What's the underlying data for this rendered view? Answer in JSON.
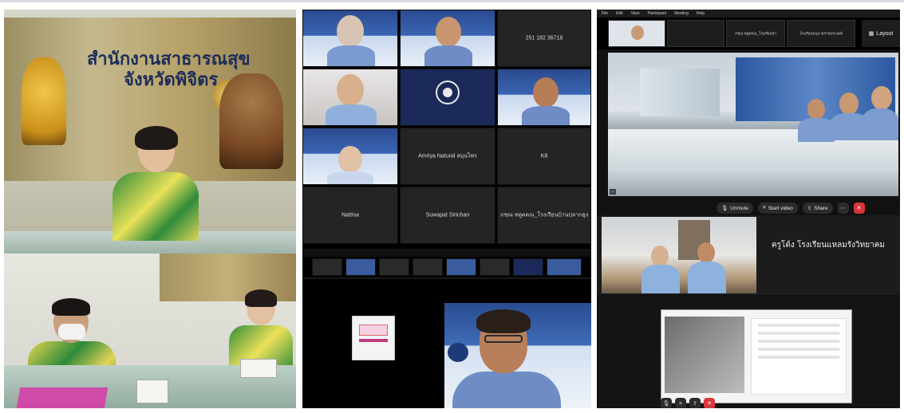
{
  "photo_top": {
    "banner_line1": "สำนักงานสาธารณสุข",
    "banner_line2": "จังหวัดพิจิตร"
  },
  "zoom_gallery": {
    "tiles": [
      {
        "label": ""
      },
      {
        "label": ""
      },
      {
        "label": "251 182 36718"
      },
      {
        "label": ""
      },
      {
        "label": ""
      },
      {
        "label": ""
      },
      {
        "label": ""
      },
      {
        "label": "Amriya Natural สมุนไพร"
      },
      {
        "label": "K8"
      },
      {
        "label": "Nattisa"
      },
      {
        "label": "Suwapat Sirichan"
      },
      {
        "label": "ภชณ หทูดดณ_โรงเรียนบ้านปลากฮุง"
      }
    ]
  },
  "zoom_desktop": {
    "menu": [
      "File",
      "Edit",
      "View",
      "Participant",
      "Meeting",
      "Help"
    ],
    "top_thumbs": [
      "",
      "",
      "ภชณ หทูดดณ_โรงเรียนบ้า",
      "โรงเรียนอนุบาลราชประสงค์",
      ""
    ],
    "layout_label": "Layout",
    "controls": {
      "unmute": "Unmute",
      "start_video": "Start video",
      "share": "Share"
    },
    "side_label": "ครูโต้ง โรงเรียนแหลมรังวิทยาคม"
  },
  "colors": {
    "zoom_dark": "#1a1a1a",
    "leave_red": "#d9353a",
    "shirt_green": "#2f8b3a",
    "shirt_yellow": "#e8e15a"
  }
}
